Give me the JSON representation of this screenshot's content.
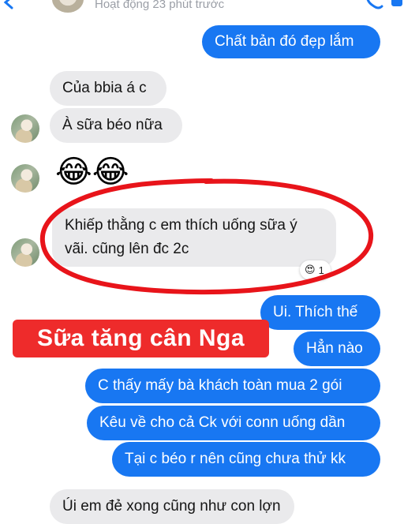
{
  "header": {
    "status_text": "Hoạt động 23 phút trước",
    "icons": [
      "back-icon",
      "phone-icon",
      "video-icon"
    ]
  },
  "messages": {
    "m1": "Chất bản đó đẹp lắm",
    "m2": "Của bbia á c",
    "m3": "À sữa béo nữa",
    "m4": "😂😂",
    "m5_line1": "Khiếp thằng c em thích uống sữa ý",
    "m5_line2": "vãi. cũng lên đc 2c",
    "m5_reaction": {
      "emoji": "😍",
      "count": "1"
    },
    "m6": "Ui. Thích thế",
    "m7": "Hẳn nào",
    "m8": "C thấy mấy bà khách toàn mua 2 gói",
    "m9": "Kêu về cho cả Ck với conn uống dần",
    "m10": "Tại c béo r nên cũng chưa thử kk",
    "m11_partial": "Úi em đẻ xong cũng như con lợn"
  },
  "overlay": {
    "sticker_text": "Sữa tăng cân Nga"
  },
  "colors": {
    "outgoing_bubble": "#1877f2",
    "incoming_bubble": "#eaeaec",
    "ring": "#e8141a",
    "sticker_bg": "#ee2b2b",
    "status_text": "#9a9ea6"
  }
}
